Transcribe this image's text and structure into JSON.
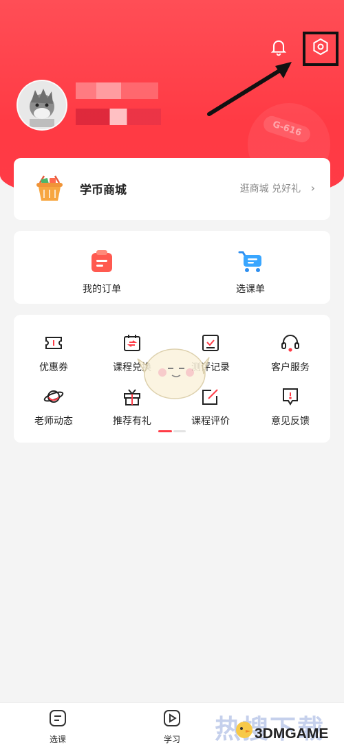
{
  "header": {
    "badge_deco": "G-616"
  },
  "mall": {
    "title": "学币商城",
    "link": "逛商城 兑好礼",
    "chevron": "›"
  },
  "orders": [
    {
      "label": "我的订单",
      "icon": "order-icon"
    },
    {
      "label": "选课单",
      "icon": "cart-icon"
    }
  ],
  "services": [
    {
      "label": "优惠券",
      "icon": "coupon-icon"
    },
    {
      "label": "课程兑换",
      "icon": "exchange-icon"
    },
    {
      "label": "测评记录",
      "icon": "assessment-icon"
    },
    {
      "label": "客户服务",
      "icon": "headset-icon"
    },
    {
      "label": "老师动态",
      "icon": "planet-icon"
    },
    {
      "label": "推荐有礼",
      "icon": "gift-icon"
    },
    {
      "label": "课程评价",
      "icon": "review-icon"
    },
    {
      "label": "意见反馈",
      "icon": "feedback-icon"
    }
  ],
  "tabbar": [
    {
      "label": "选课",
      "icon": "course-select-icon"
    },
    {
      "label": "学习",
      "icon": "play-icon"
    }
  ],
  "watermark": {
    "cn": "热搜下载",
    "brand": "3DMGAME"
  },
  "colors": {
    "brand_red": "#ff3b46",
    "orange": "#f7a640",
    "blue": "#2e8ff0"
  }
}
